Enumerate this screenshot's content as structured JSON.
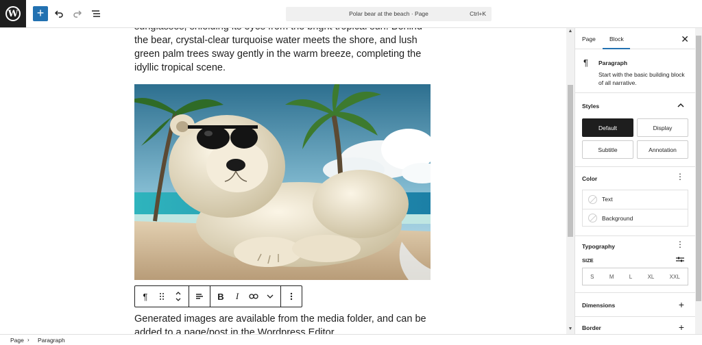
{
  "topbar": {
    "logo_letter": "W",
    "add_icon": "plus-icon",
    "command": {
      "title": "Polar bear at the beach · Page",
      "shortcut": "Ctrl+K"
    }
  },
  "editor": {
    "para_above": "sunglasses, shielding its eyes from the bright tropical sun. Behind the bear, crystal-clear turquoise water meets the shore, and lush green palm trees sway gently in the warm breeze, completing the idyllic tropical scene.",
    "para_below": "Generated images are available from the media folder, and can be added to a page/post in the Wordpress Editor.",
    "toolbar": [
      "pilcrow-icon",
      "drag-handle-icon",
      "move-arrows-icon",
      "align-icon",
      "bold-icon",
      "italic-icon",
      "link-icon",
      "chevron-down-icon",
      "more-options-icon"
    ],
    "toolbar_glyphs": {
      "bold": "B",
      "italic": "I",
      "pilcrow": "¶"
    }
  },
  "sidebar": {
    "tabs": [
      "Page",
      "Block"
    ],
    "active_tab": "Block",
    "block": {
      "name": "Paragraph",
      "description": "Start with the basic building block of all narrative."
    },
    "styles": {
      "title": "Styles",
      "options": [
        "Default",
        "Display",
        "Subtitle",
        "Annotation"
      ],
      "selected": "Default"
    },
    "color": {
      "title": "Color",
      "items": [
        "Text",
        "Background"
      ]
    },
    "typography": {
      "title": "Typography",
      "size_label": "SIZE",
      "sizes": [
        "S",
        "M",
        "L",
        "XL",
        "XXL"
      ]
    },
    "dimensions": {
      "title": "Dimensions"
    },
    "border": {
      "title": "Border"
    }
  },
  "statusbar": {
    "breadcrumbs": [
      "Page",
      "Paragraph"
    ]
  },
  "colors": {
    "accent": "#2271b1",
    "dark": "#1e1e1e"
  }
}
